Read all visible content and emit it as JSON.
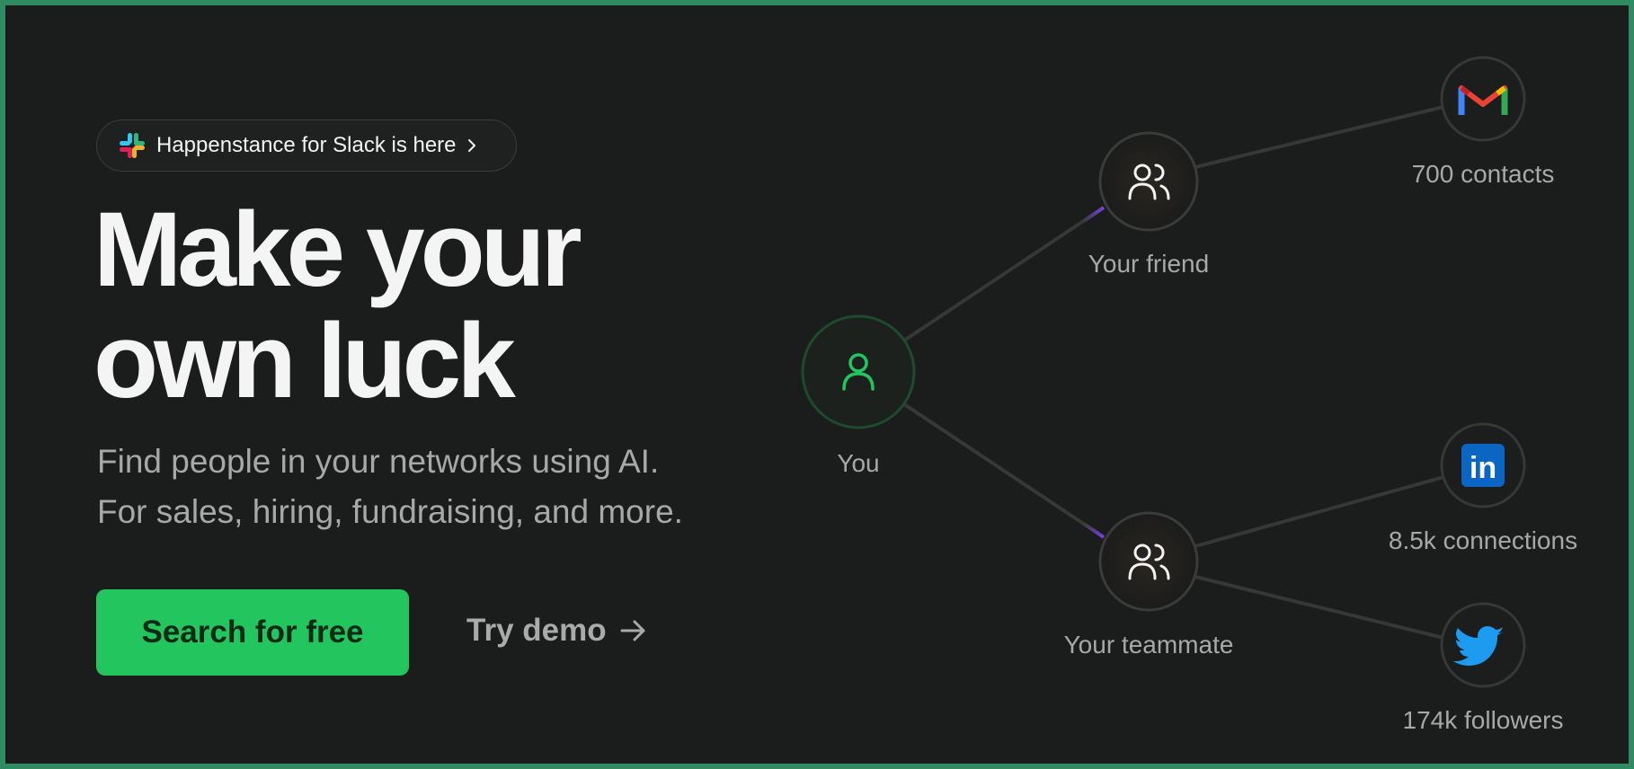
{
  "announcement": {
    "label": "Happenstance for Slack is here"
  },
  "hero": {
    "headline_line1": "Make your",
    "headline_line2": "own luck",
    "subtitle_line1": "Find people in your networks using AI.",
    "subtitle_line2": "For sales, hiring, fundraising, and more."
  },
  "cta": {
    "primary_label": "Search for free",
    "secondary_label": "Try demo"
  },
  "network": {
    "you": "You",
    "friend": "Your friend",
    "teammate": "Your teammate",
    "gmail": "700 contacts",
    "linkedin": "8.5k connections",
    "twitter": "174k followers"
  },
  "colors": {
    "accent": "#22c55e",
    "background": "#1b1c1c",
    "frame": "#2e8b62",
    "muted_text": "#a7a8a8"
  },
  "icons": [
    "slack-icon",
    "chevron-right-icon",
    "arrow-right-icon",
    "user-icon",
    "users-icon",
    "gmail-icon",
    "linkedin-icon",
    "twitter-icon"
  ]
}
